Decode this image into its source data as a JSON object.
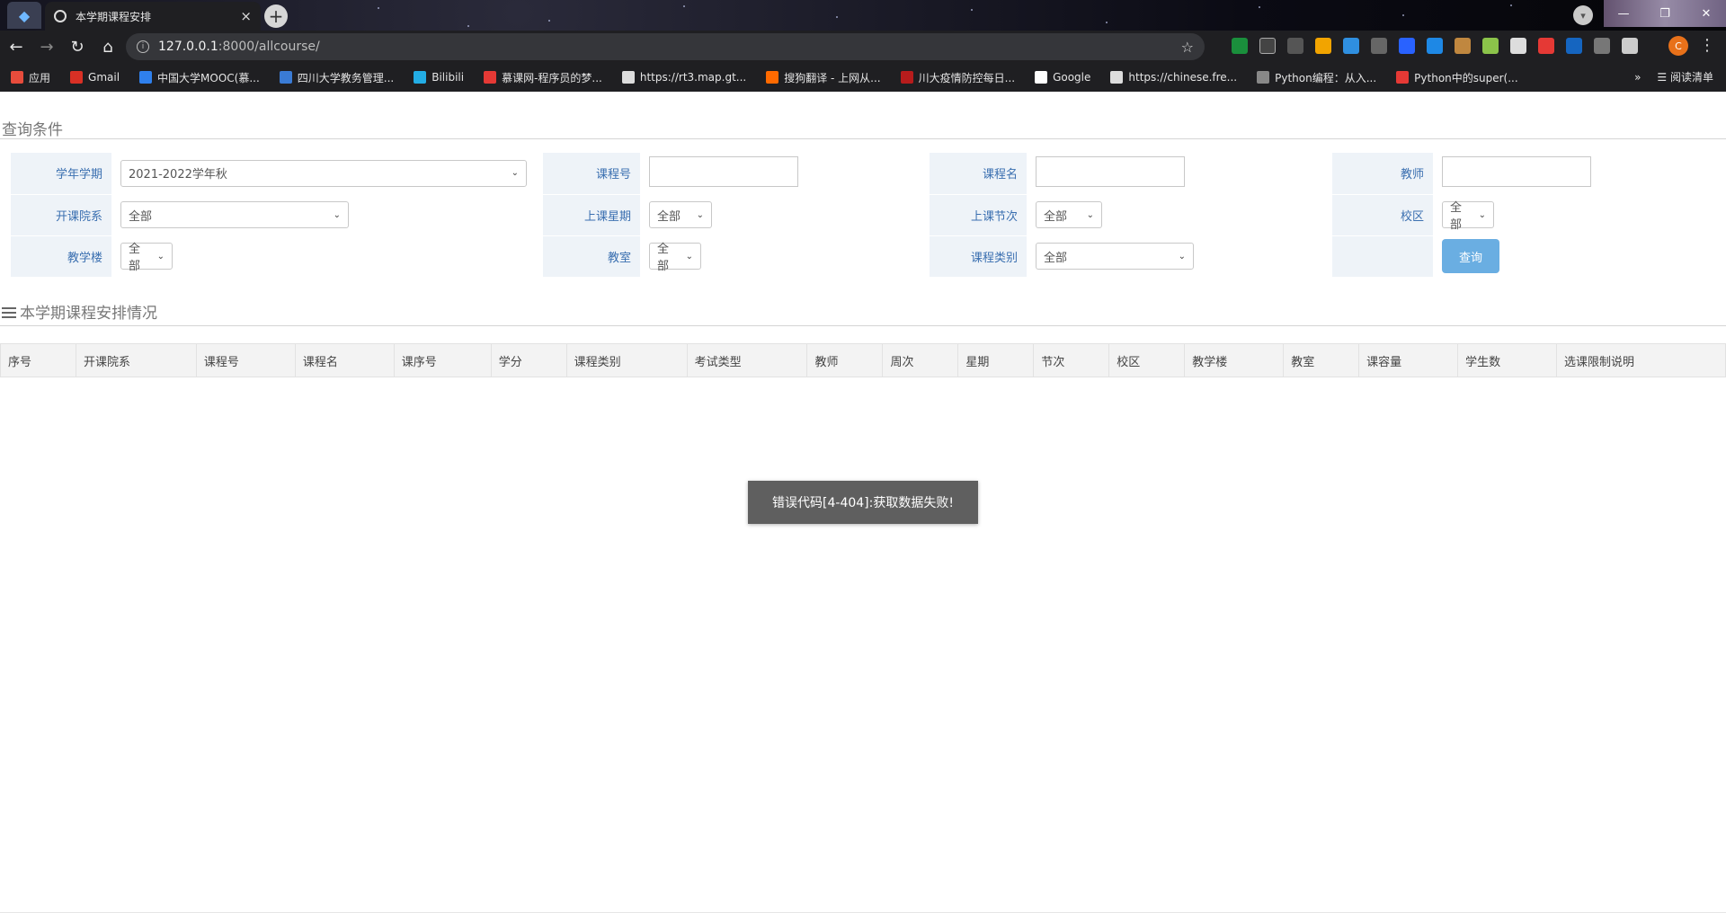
{
  "browser": {
    "tab_title": "本学期课程安排",
    "tab_close": "×",
    "new_tab": "+",
    "url_host": "127.0.0.1",
    "url_rest": ":8000/allcourse/",
    "profile_initial": "C",
    "bookmarks": [
      {
        "label": "应用",
        "color": "#e74c3c"
      },
      {
        "label": "Gmail",
        "color": "#d93025"
      },
      {
        "label": "中国大学MOOC(慕...",
        "color": "#2f80ed"
      },
      {
        "label": "四川大学教务管理...",
        "color": "#3a7bd5"
      },
      {
        "label": "Bilibili",
        "color": "#23ade5"
      },
      {
        "label": "慕课网-程序员的梦...",
        "color": "#e53935"
      },
      {
        "label": "https://rt3.map.gt...",
        "color": "#dddddd"
      },
      {
        "label": "搜狗翻译 - 上网从...",
        "color": "#ff6a00"
      },
      {
        "label": "川大疫情防控每日...",
        "color": "#b71c1c"
      },
      {
        "label": "Google",
        "color": "#ffffff"
      },
      {
        "label": "https://chinese.fre...",
        "color": "#dddddd"
      },
      {
        "label": "Python编程：从入...",
        "color": "#888888"
      },
      {
        "label": "Python中的super(...",
        "color": "#e53935"
      }
    ],
    "more_bookmarks": "»",
    "reading_list": "阅读清单"
  },
  "query": {
    "section_title": "查询条件",
    "fields": {
      "term_label": "学年学期",
      "term_value": "2021-2022学年秋",
      "course_no_label": "课程号",
      "course_name_label": "课程名",
      "teacher_label": "教师",
      "dept_label": "开课院系",
      "dept_value": "全部",
      "weekday_label": "上课星期",
      "weekday_value": "全部",
      "period_label": "上课节次",
      "period_value": "全部",
      "campus_label": "校区",
      "campus_value": "全部",
      "building_label": "教学楼",
      "building_value": "全部",
      "room_label": "教室",
      "room_value": "全部",
      "category_label": "课程类别",
      "category_value": "全部"
    },
    "search_button": "查询"
  },
  "schedule": {
    "section_title": "本学期课程安排情况",
    "columns": [
      "序号",
      "开课院系",
      "课程号",
      "课程名",
      "课序号",
      "学分",
      "课程类别",
      "考试类型",
      "教师",
      "周次",
      "星期",
      "节次",
      "校区",
      "教学楼",
      "教室",
      "课容量",
      "学生数",
      "选课限制说明"
    ]
  },
  "toast": "错误代码[4-404]:获取数据失败!"
}
